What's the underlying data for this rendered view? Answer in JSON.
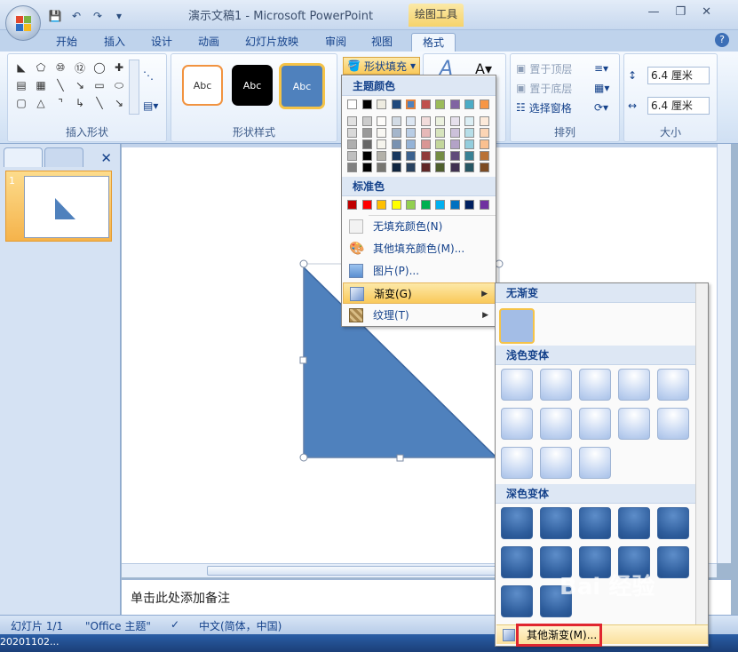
{
  "window": {
    "title": "演示文稿1 - Microsoft PowerPoint",
    "context_tab": "绘图工具"
  },
  "tabs": [
    "开始",
    "插入",
    "设计",
    "动画",
    "幻灯片放映",
    "审阅",
    "视图",
    "格式"
  ],
  "ribbon": {
    "group_insert_shapes": "插入形状",
    "group_shape_styles": "形状样式",
    "group_arrange": "排列",
    "group_size": "大小",
    "style_samples": [
      "Abc",
      "Abc",
      "Abc"
    ],
    "shape_fill_button": "形状填充",
    "bring_front": "置于顶层",
    "send_back": "置于底层",
    "selection_pane": "选择窗格",
    "height_value": "6.4 厘米",
    "width_value": "6.4 厘米"
  },
  "fill_menu": {
    "theme_colors": "主题颜色",
    "standard_colors": "标准色",
    "no_fill": "无填充颜色(N)",
    "more_colors": "其他填充颜色(M)...",
    "picture": "图片(P)...",
    "gradient": "渐变(G)",
    "texture": "纹理(T)"
  },
  "grad_menu": {
    "no_gradient": "无渐变",
    "light_variations": "浅色变体",
    "dark_variations": "深色变体",
    "more_gradients": "其他渐变(M)..."
  },
  "colors": {
    "theme_top": [
      "#ffffff",
      "#000000",
      "#eeece1",
      "#1f497d",
      "#4f81bd",
      "#c0504d",
      "#9bbb59",
      "#8064a2",
      "#4bacc6",
      "#f79646"
    ],
    "standard": [
      "#c00000",
      "#ff0000",
      "#ffc000",
      "#ffff00",
      "#92d050",
      "#00b050",
      "#00b0f0",
      "#0070c0",
      "#002060",
      "#7030a0"
    ],
    "shape_fill": "#4f81bd"
  },
  "slide_panel": {
    "slide_number": "1"
  },
  "notes": {
    "placeholder": "单击此处添加备注"
  },
  "status": {
    "slide_info": "幻灯片 1/1",
    "theme": "\"Office 主题\"",
    "language": "中文(简体，中国)"
  },
  "taskbar": {
    "clock": "20201102..."
  },
  "watermark": "Bai 经验"
}
